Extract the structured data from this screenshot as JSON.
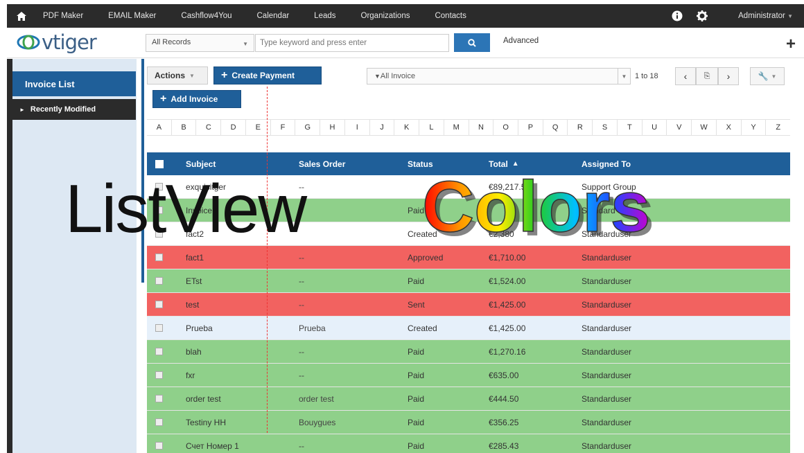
{
  "topnav": {
    "items": [
      "PDF Maker",
      "EMAIL Maker",
      "Cashflow4You",
      "Calendar",
      "Leads",
      "Organizations",
      "Contacts"
    ],
    "user": "Administrator"
  },
  "search": {
    "records_select": "All Records",
    "placeholder": "Type keyword and press enter",
    "advanced": "Advanced"
  },
  "sidebar": {
    "title": "Invoice List",
    "recent": "Recently Modified"
  },
  "toolbar": {
    "actions": "Actions",
    "create_payment": "Create Payment",
    "add_invoice": "Add Invoice",
    "filter": "All Invoice",
    "page_count": "1 to 18"
  },
  "alphabet": [
    "A",
    "B",
    "C",
    "D",
    "E",
    "F",
    "G",
    "H",
    "I",
    "J",
    "K",
    "L",
    "M",
    "N",
    "O",
    "P",
    "Q",
    "R",
    "S",
    "T",
    "U",
    "V",
    "W",
    "X",
    "Y",
    "Z"
  ],
  "table": {
    "headers": {
      "subject": "Subject",
      "sales_order": "Sales Order",
      "status": "Status",
      "total": "Total",
      "assigned": "Assigned To"
    },
    "rows": [
      {
        "subject": "exquisitger",
        "sales_order": "--",
        "status": "",
        "total": "€89,217.50",
        "assigned": "Support Group",
        "color": "#ffffff"
      },
      {
        "subject": "Invoice",
        "sales_order": "",
        "status": "Paid",
        "total": "",
        "assigned": "Standard",
        "color": "#8fd08a"
      },
      {
        "subject": "fact2",
        "sales_order": "",
        "status": "Created",
        "total": "€2,380",
        "assigned": "Standarduser",
        "color": "#ffffff"
      },
      {
        "subject": "fact1",
        "sales_order": "--",
        "status": "Approved",
        "total": "€1,710.00",
        "assigned": "Standarduser",
        "color": "#f26260"
      },
      {
        "subject": "ETst",
        "sales_order": "--",
        "status": "Paid",
        "total": "€1,524.00",
        "assigned": "Standarduser",
        "color": "#8fd08a"
      },
      {
        "subject": "test",
        "sales_order": "--",
        "status": "Sent",
        "total": "€1,425.00",
        "assigned": "Standarduser",
        "color": "#f26260"
      },
      {
        "subject": "Prueba",
        "sales_order": "Prueba",
        "status": "Created",
        "total": "€1,425.00",
        "assigned": "Standarduser",
        "color": "#e6f0fa"
      },
      {
        "subject": "blah",
        "sales_order": "--",
        "status": "Paid",
        "total": "€1,270.16",
        "assigned": "Standarduser",
        "color": "#8fd08a"
      },
      {
        "subject": "fxr",
        "sales_order": "--",
        "status": "Paid",
        "total": "€635.00",
        "assigned": "Standarduser",
        "color": "#8fd08a"
      },
      {
        "subject": "order test",
        "sales_order": "order test",
        "status": "Paid",
        "total": "€444.50",
        "assigned": "Standarduser",
        "color": "#8fd08a"
      },
      {
        "subject": "Testiny HH",
        "sales_order": "Bouygues",
        "status": "Paid",
        "total": "€356.25",
        "assigned": "Standarduser",
        "color": "#8fd08a"
      },
      {
        "subject": "Счет Номер 1",
        "sales_order": "--",
        "status": "Paid",
        "total": "€285.43",
        "assigned": "Standarduser",
        "color": "#8fd08a"
      }
    ]
  },
  "overlay": {
    "list_view": "ListView",
    "colors": "Colors"
  },
  "colors": {
    "primary": "#1f5f99",
    "paid": "#8fd08a",
    "alert": "#f26260",
    "nav": "#2b2b2b"
  }
}
